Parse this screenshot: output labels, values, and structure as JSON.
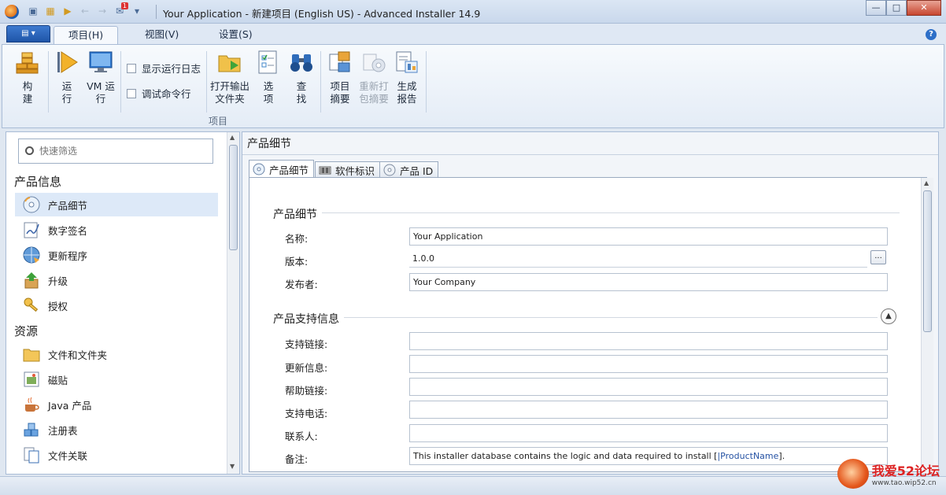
{
  "window": {
    "title": "Your Application - 新建项目 (English US) - Advanced Installer 14.9",
    "qat_badge": "1",
    "minimize": "—",
    "maximize": "□",
    "close": "✕"
  },
  "ribbon": {
    "file_label": "▤ ▾",
    "tabs": [
      "项目(H)",
      "视图(V)",
      "设置(S)"
    ],
    "help": "?",
    "buttons": {
      "build": "构\n建",
      "build_arrow": "▾",
      "run": "运\n行",
      "vm_run": "VM 运\n行",
      "vm_arrow": "▾",
      "open_output": "打开输出\n文件夹",
      "options": "选\n项",
      "find": "查\n找",
      "summary": "项目\n摘要",
      "repackage": "重新打\n包摘要",
      "report": "生成\n报告"
    },
    "checkboxes": [
      "显示运行日志",
      "调试命令行"
    ],
    "group_label": "项目"
  },
  "left": {
    "filter_placeholder": "快速筛选",
    "sections": [
      {
        "title": "产品信息",
        "items": [
          "产品细节",
          "数字签名",
          "更新程序",
          "升级",
          "授权"
        ]
      },
      {
        "title": "资源",
        "items": [
          "文件和文件夹",
          "磁贴",
          "Java 产品",
          "注册表",
          "文件关联"
        ]
      }
    ]
  },
  "right": {
    "page_title": "产品细节",
    "tabs": [
      "产品细节",
      "软件标识",
      "产品 ID"
    ],
    "details": {
      "title": "产品细节",
      "fields": [
        {
          "label": "名称:",
          "value": "Your Application"
        },
        {
          "label": "版本:",
          "value": "1.0.0",
          "button": "..."
        },
        {
          "label": "发布者:",
          "value": "Your Company"
        }
      ]
    },
    "support": {
      "title": "产品支持信息",
      "fields": [
        {
          "label": "支持链接:",
          "value": ""
        },
        {
          "label": "更新信息:",
          "value": ""
        },
        {
          "label": "帮助链接:",
          "value": ""
        },
        {
          "label": "支持电话:",
          "value": ""
        },
        {
          "label": "联系人:",
          "value": ""
        },
        {
          "label": "备注:",
          "value_prefix": "This installer database contains the logic and data required to install [",
          "value_highlight": "|ProductName",
          "value_suffix": "]."
        }
      ]
    }
  },
  "watermark": {
    "text": "我爱52论坛",
    "url": "www.tao.wip52.cn"
  },
  "colors": {
    "accent": "#1f55a8",
    "selection": "#dde9f8",
    "highlight_text": "#2552a3"
  }
}
